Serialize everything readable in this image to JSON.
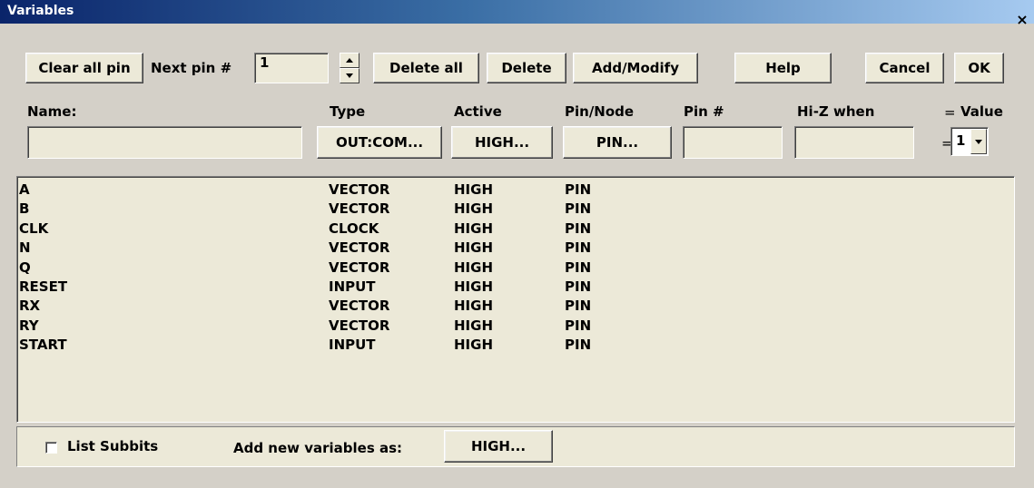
{
  "window": {
    "title": "Variables",
    "close_glyph": "×"
  },
  "toolbar": {
    "clear_all_pin": "Clear all pin",
    "next_pin_label": "Next pin #",
    "next_pin_value": "1",
    "delete_all": "Delete all",
    "delete": "Delete",
    "add_modify": "Add/Modify",
    "help": "Help",
    "cancel": "Cancel",
    "ok": "OK"
  },
  "form": {
    "name_label": "Name:",
    "type_label": "Type",
    "active_label": "Active",
    "pin_node_label": "Pin/Node",
    "pin_num_label": "Pin #",
    "hiz_label": "Hi-Z when",
    "eq_label": "=",
    "value_label": "Value",
    "name_value": "",
    "type_button": "OUT:COM...",
    "active_button": "HIGH...",
    "pin_node_button": "PIN...",
    "pin_num_value": "",
    "hiz_value": "",
    "eq2_label": "=",
    "value_selected": "1"
  },
  "variables": [
    {
      "name": "A",
      "type": "VECTOR",
      "active": "HIGH",
      "pin": "PIN"
    },
    {
      "name": "B",
      "type": "VECTOR",
      "active": "HIGH",
      "pin": "PIN"
    },
    {
      "name": "CLK",
      "type": "CLOCK",
      "active": "HIGH",
      "pin": "PIN"
    },
    {
      "name": "N",
      "type": "VECTOR",
      "active": "HIGH",
      "pin": "PIN"
    },
    {
      "name": "Q",
      "type": "VECTOR",
      "active": "HIGH",
      "pin": "PIN"
    },
    {
      "name": "RESET",
      "type": "INPUT",
      "active": "HIGH",
      "pin": "PIN"
    },
    {
      "name": "RX",
      "type": "VECTOR",
      "active": "HIGH",
      "pin": "PIN"
    },
    {
      "name": "RY",
      "type": "VECTOR",
      "active": "HIGH",
      "pin": "PIN"
    },
    {
      "name": "START",
      "type": "INPUT",
      "active": "HIGH",
      "pin": "PIN"
    }
  ],
  "bottom": {
    "list_subbits": "List Subbits",
    "list_subbits_checked": false,
    "add_new_label": "Add new variables as:",
    "add_new_button": "HIGH..."
  }
}
